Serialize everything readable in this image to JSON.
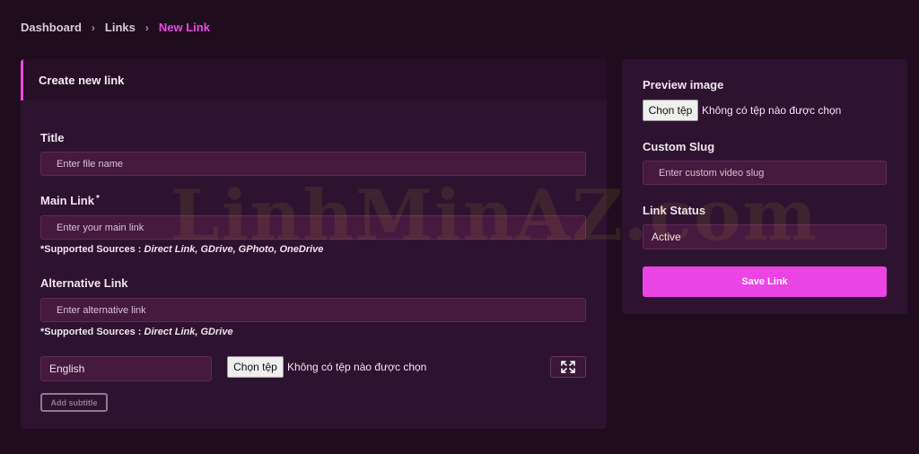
{
  "breadcrumb": {
    "items": [
      "Dashboard",
      "Links",
      "New Link"
    ],
    "separator": "›"
  },
  "create_card": {
    "header": "Create new link",
    "title": {
      "label": "Title",
      "placeholder": "Enter file name"
    },
    "main_link": {
      "label": "Main Link",
      "required_mark": "*",
      "placeholder": "Enter your main link"
    },
    "main_support": {
      "prefix": "*Supported Sources : ",
      "sources": "Direct Link, GDrive, GPhoto, OneDrive"
    },
    "alt_link": {
      "label": "Alternative Link",
      "placeholder": "Enter alternative link"
    },
    "alt_support": {
      "prefix": "*Supported Sources : ",
      "sources": "Direct Link, GDrive"
    },
    "subtitle": {
      "language": "English",
      "file_button": "Chọn tệp",
      "file_status": "Không có tệp nào được chọn",
      "add_button": "Add subtitle"
    }
  },
  "side_card": {
    "preview": {
      "label": "Preview image",
      "file_button": "Chọn tệp",
      "file_status": "Không có tệp nào được chọn"
    },
    "slug": {
      "label": "Custom Slug",
      "placeholder": "Enter custom video slug"
    },
    "status": {
      "label": "Link Status",
      "value": "Active"
    },
    "save_button": "Save Link"
  },
  "watermark": "LinhMinAZ.com",
  "colors": {
    "accent": "#e54be0",
    "background": "#1f0d1f",
    "card": "#2e1330",
    "input": "#46193f"
  },
  "icons": {
    "expand": "expand-arrows-icon",
    "separator": "chevron-right-icon"
  }
}
